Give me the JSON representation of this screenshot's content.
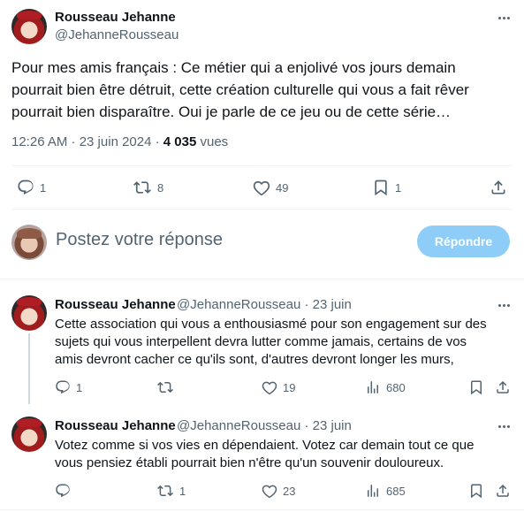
{
  "main_tweet": {
    "author_name": "Rousseau Jehanne",
    "author_handle": "@JehanneRousseau",
    "text_lines": [
      "Pour mes amis français : Ce métier qui a enjolivé vos jours demain",
      "pourrait bien être détruit, cette création culturelle qui vous a fait rêver",
      "pourrait bien disparaître. Oui je parle de ce jeu ou de cette série…"
    ],
    "time": "12:26 AM · 23 juin 2024 · ",
    "views_count": "4 035",
    "views_label": " vues",
    "stats": {
      "replies": "1",
      "reposts": "8",
      "likes": "49",
      "bookmarks": "1"
    }
  },
  "reply_box": {
    "placeholder": "Postez votre réponse",
    "button_label": "Répondre"
  },
  "replies": [
    {
      "author_name": "Rousseau Jehanne",
      "author_handle": "@JehanneRousseau · 23 juin",
      "text_lines": [
        "Cette association qui vous a enthousiasmé pour son engagement sur des",
        "sujets qui vous interpellent devra lutter comme jamais, certains de vos",
        "amis devront cacher ce qu'ils sont, d'autres devront longer les murs,"
      ],
      "stats": {
        "replies": "1",
        "reposts": "",
        "likes": "19",
        "views": "680"
      }
    },
    {
      "author_name": "Rousseau Jehanne",
      "author_handle": "@JehanneRousseau · 23 juin",
      "text_lines": [
        "Votez comme si vos vies en dépendaient. Votez car demain tout ce que",
        "vous pensiez établi pourrait bien n'être qu'un souvenir douloureux."
      ],
      "stats": {
        "replies": "",
        "reposts": "1",
        "likes": "23",
        "views": "685"
      }
    }
  ],
  "icons": {
    "reply": "reply-icon",
    "repost": "repost-icon",
    "like": "heart-icon",
    "bookmark": "bookmark-icon",
    "share": "share-icon",
    "views": "views-chart-icon",
    "more": "more-icon"
  },
  "colors": {
    "accent_disabled": "#8ecdf7",
    "secondary_text": "#536471",
    "primary_text": "#0f1419"
  }
}
